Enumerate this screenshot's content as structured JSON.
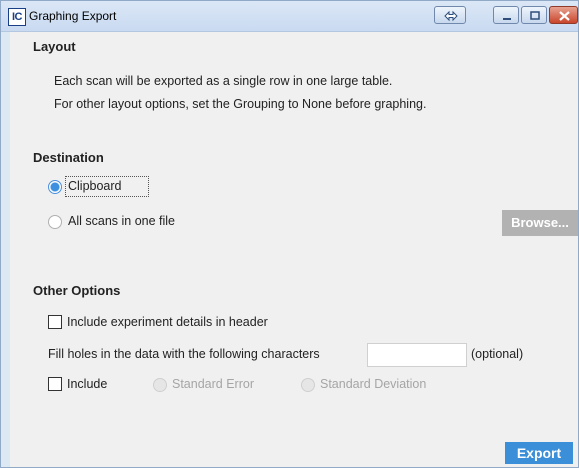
{
  "window": {
    "icon_text": "IC",
    "title": "Graphing Export"
  },
  "layout": {
    "heading": "Layout",
    "line1": "Each scan will be exported as a single row in one large table.",
    "line2": "For other layout options, set the Grouping to None before graphing."
  },
  "destination": {
    "heading": "Destination",
    "options": [
      {
        "label": "Clipboard",
        "selected": true
      },
      {
        "label": "All scans in one file",
        "selected": false
      }
    ],
    "browse_label": "Browse..."
  },
  "other_options": {
    "heading": "Other Options",
    "include_details_label": "Include experiment details in header",
    "include_details_checked": false,
    "fill_holes_label": "Fill holes in the data with the following characters",
    "fill_holes_value": "",
    "optional_label": "(optional)",
    "include_label": "Include",
    "include_checked": false,
    "standard_error_label": "Standard Error",
    "standard_error_selected": true,
    "standard_deviation_label": "Standard Deviation"
  },
  "export_label": "Export",
  "colors": {
    "accent_blue": "#3a8fd8",
    "disabled_gray": "#b2b2b2"
  }
}
